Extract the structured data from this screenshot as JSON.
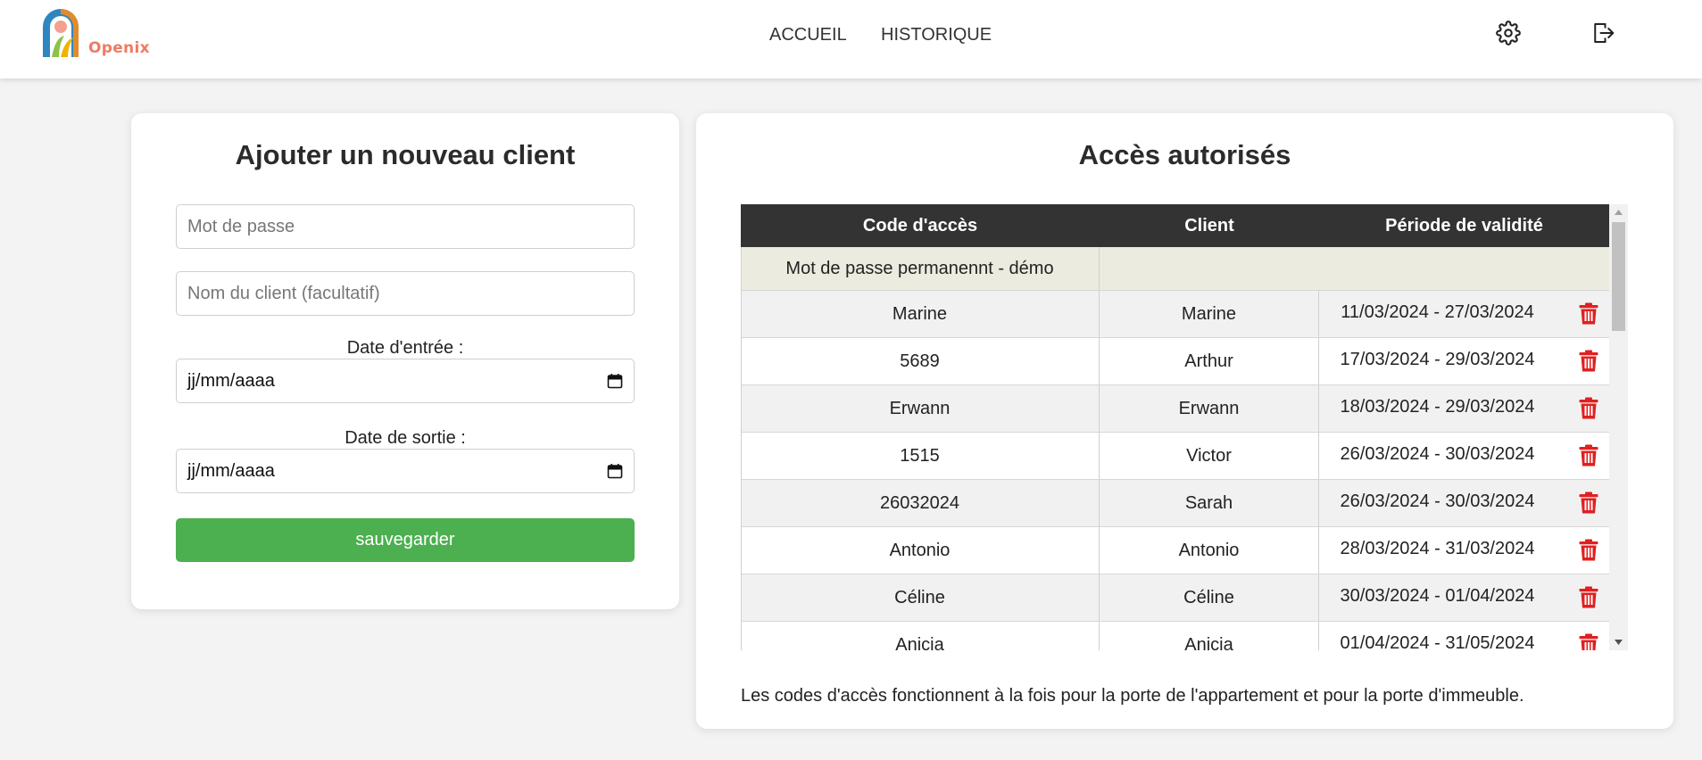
{
  "brand": {
    "name": "Openix"
  },
  "nav": {
    "home": "ACCUEIL",
    "history": "HISTORIQUE"
  },
  "header_icons": [
    "gear-icon",
    "logout-icon"
  ],
  "add_client": {
    "title": "Ajouter un nouveau client",
    "password_placeholder": "Mot de passe",
    "client_name_placeholder": "Nom du client (facultatif)",
    "entry_date_label": "Date d'entrée :",
    "entry_date_value": "jj/mm/aaaa",
    "exit_date_label": "Date de sortie :",
    "exit_date_value": "jj/mm/aaaa",
    "save_label": "sauvegarder"
  },
  "access": {
    "title": "Accès autorisés",
    "columns": [
      "Code d'accès",
      "Client",
      "Période de validité"
    ],
    "permanent_row": "Mot de passe permanennt - démo",
    "rows": [
      {
        "code": "Marine",
        "client": "Marine",
        "period": "11/03/2024 - 27/03/2024"
      },
      {
        "code": "5689",
        "client": "Arthur",
        "period": "17/03/2024 - 29/03/2024"
      },
      {
        "code": "Erwann",
        "client": "Erwann",
        "period": "18/03/2024 - 29/03/2024"
      },
      {
        "code": "1515",
        "client": "Victor",
        "period": "26/03/2024 - 30/03/2024"
      },
      {
        "code": "26032024",
        "client": "Sarah",
        "period": "26/03/2024 - 30/03/2024"
      },
      {
        "code": "Antonio",
        "client": "Antonio",
        "period": "28/03/2024 - 31/03/2024"
      },
      {
        "code": "Céline",
        "client": "Céline",
        "period": "30/03/2024 - 01/04/2024"
      },
      {
        "code": "Anicia",
        "client": "Anicia",
        "period": "01/04/2024 - 31/05/2024"
      }
    ],
    "note": "Les codes d'accès fonctionnent à la fois pour la porte de l'appartement et pour la porte d'immeuble."
  },
  "colors": {
    "accent_green": "#4caf50",
    "table_header": "#333333",
    "delete_red": "#e02020",
    "brand_orange": "#ef7b62"
  }
}
